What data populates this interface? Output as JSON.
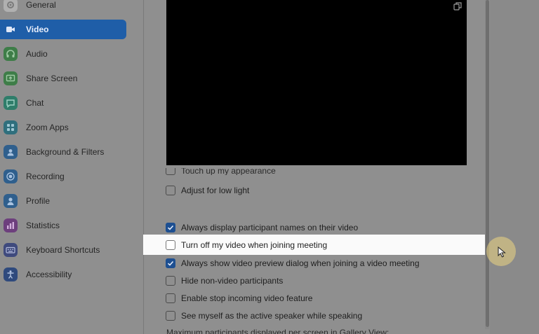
{
  "sidebar": {
    "items": [
      {
        "label": "General",
        "icon": "gear-icon",
        "color": "#b8b8b8"
      },
      {
        "label": "Video",
        "icon": "video-camera-icon",
        "color": "#1f5ea8",
        "active": true
      },
      {
        "label": "Audio",
        "icon": "headphones-icon",
        "color": "#3f8f4a"
      },
      {
        "label": "Share Screen",
        "icon": "share-screen-icon",
        "color": "#3f8f4a"
      },
      {
        "label": "Chat",
        "icon": "chat-icon",
        "color": "#2f8f7a"
      },
      {
        "label": "Zoom Apps",
        "icon": "apps-icon",
        "color": "#2f7f9a"
      },
      {
        "label": "Background & Filters",
        "icon": "background-icon",
        "color": "#2f6fa8"
      },
      {
        "label": "Recording",
        "icon": "recording-icon",
        "color": "#2f6fa8"
      },
      {
        "label": "Profile",
        "icon": "profile-icon",
        "color": "#2f6fa8"
      },
      {
        "label": "Statistics",
        "icon": "statistics-icon",
        "color": "#7a3f8f"
      },
      {
        "label": "Keyboard Shortcuts",
        "icon": "keyboard-icon",
        "color": "#3f4f8f"
      },
      {
        "label": "Accessibility",
        "icon": "accessibility-icon",
        "color": "#2f4f8f"
      }
    ]
  },
  "video": {
    "partial_option": "Touch up my appearance",
    "options": [
      {
        "label": "Adjust for low light",
        "checked": false
      },
      {
        "label": "Always display participant names on their video",
        "checked": true
      },
      {
        "label": "Turn off my video when joining meeting",
        "checked": false,
        "highlighted": true
      },
      {
        "label": "Always show video preview dialog when joining a video meeting",
        "checked": true
      },
      {
        "label": "Hide non-video participants",
        "checked": false
      },
      {
        "label": "Enable stop incoming video feature",
        "checked": false
      },
      {
        "label": "See myself as the active speaker while speaking",
        "checked": false
      }
    ],
    "gallery_label": "Maximum participants displayed per screen in Gallery View:"
  },
  "colors": {
    "accent": "#1f5ea8",
    "checkbox_checked": "#1d4f91",
    "highlight": "#fafafa"
  }
}
